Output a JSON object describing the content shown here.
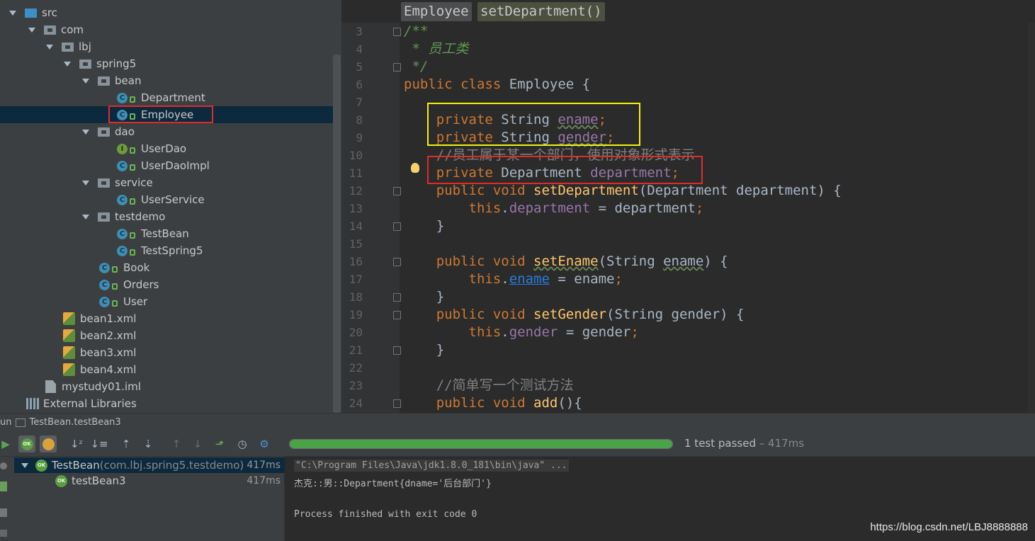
{
  "project_tree": {
    "items": [
      {
        "label": "src",
        "kind": "folder-src",
        "level": 0,
        "expanded": true
      },
      {
        "label": "com",
        "kind": "package",
        "level": 1,
        "expanded": true
      },
      {
        "label": "lbj",
        "kind": "package",
        "level": 2,
        "expanded": true
      },
      {
        "label": "spring5",
        "kind": "package",
        "level": 3,
        "expanded": true
      },
      {
        "label": "bean",
        "kind": "package",
        "level": 4,
        "expanded": true
      },
      {
        "label": "Department",
        "kind": "class",
        "level": 5
      },
      {
        "label": "Employee",
        "kind": "class",
        "level": 5,
        "selected": true
      },
      {
        "label": "dao",
        "kind": "package",
        "level": 4,
        "expanded": true
      },
      {
        "label": "UserDao",
        "kind": "interface",
        "level": 5
      },
      {
        "label": "UserDaoImpl",
        "kind": "class",
        "level": 5
      },
      {
        "label": "service",
        "kind": "package",
        "level": 4,
        "expanded": true
      },
      {
        "label": "UserService",
        "kind": "class",
        "level": 5
      },
      {
        "label": "testdemo",
        "kind": "package",
        "level": 4,
        "expanded": true
      },
      {
        "label": "TestBean",
        "kind": "class",
        "level": 5
      },
      {
        "label": "TestSpring5",
        "kind": "class",
        "level": 5
      },
      {
        "label": "Book",
        "kind": "class",
        "level": 4
      },
      {
        "label": "Orders",
        "kind": "class",
        "level": 4
      },
      {
        "label": "User",
        "kind": "class",
        "level": 4
      },
      {
        "label": "bean1.xml",
        "kind": "xml",
        "level": 2
      },
      {
        "label": "bean2.xml",
        "kind": "xml",
        "level": 2
      },
      {
        "label": "bean3.xml",
        "kind": "xml",
        "level": 2
      },
      {
        "label": "bean4.xml",
        "kind": "xml",
        "level": 2
      },
      {
        "label": "mystudy01.iml",
        "kind": "iml",
        "level": 1
      },
      {
        "label": "External Libraries",
        "kind": "libs",
        "level": 0
      }
    ]
  },
  "editor": {
    "breadcrumb": [
      "Employee",
      "setDepartment()"
    ],
    "lines": [
      {
        "num": "3",
        "tokens": [
          [
            "doc",
            "/**"
          ]
        ]
      },
      {
        "num": "4",
        "tokens": [
          [
            "doc",
            " * 员工类"
          ]
        ]
      },
      {
        "num": "5",
        "tokens": [
          [
            "doc",
            " */"
          ]
        ]
      },
      {
        "num": "6",
        "tokens": [
          [
            "kw",
            "public class "
          ],
          [
            "plain",
            "Employee {"
          ]
        ]
      },
      {
        "num": "7",
        "tokens": []
      },
      {
        "num": "8",
        "tokens": [
          [
            "plain",
            "    "
          ],
          [
            "kw",
            "private "
          ],
          [
            "plain",
            "String "
          ],
          [
            "fld squig",
            "ename"
          ],
          [
            "kw",
            ";"
          ]
        ]
      },
      {
        "num": "9",
        "tokens": [
          [
            "plain",
            "    "
          ],
          [
            "kw",
            "private "
          ],
          [
            "plain",
            "String "
          ],
          [
            "fld squig",
            "gender"
          ],
          [
            "kw",
            ";"
          ]
        ]
      },
      {
        "num": "10",
        "tokens": [
          [
            "cmt",
            "    //员工属于某一个部门，使用对象形式表示"
          ]
        ]
      },
      {
        "num": "11",
        "tokens": [
          [
            "plain",
            "    "
          ],
          [
            "kw",
            "private "
          ],
          [
            "plain",
            "Department "
          ],
          [
            "fld",
            "department"
          ],
          [
            "kw",
            ";"
          ]
        ]
      },
      {
        "num": "12",
        "tokens": [
          [
            "plain",
            "    "
          ],
          [
            "kw",
            "public void "
          ],
          [
            "fn",
            "setDepartment"
          ],
          [
            "plain",
            "(Department department) {"
          ]
        ]
      },
      {
        "num": "13",
        "tokens": [
          [
            "plain",
            "        "
          ],
          [
            "kw",
            "this"
          ],
          [
            "plain",
            "."
          ],
          [
            "fld",
            "department"
          ],
          [
            "plain",
            " = department"
          ],
          [
            "kw",
            ";"
          ]
        ]
      },
      {
        "num": "14",
        "tokens": [
          [
            "plain",
            "    }"
          ]
        ]
      },
      {
        "num": "15",
        "tokens": []
      },
      {
        "num": "16",
        "tokens": [
          [
            "plain",
            "    "
          ],
          [
            "kw",
            "public void "
          ],
          [
            "fn squig",
            "setEname"
          ],
          [
            "plain",
            "(String "
          ],
          [
            "plain squig",
            "ename"
          ],
          [
            "plain",
            ") {"
          ]
        ]
      },
      {
        "num": "17",
        "tokens": [
          [
            "plain",
            "        "
          ],
          [
            "kw",
            "this"
          ],
          [
            "plain",
            "."
          ],
          [
            "link",
            "ename"
          ],
          [
            "plain",
            " = ename"
          ],
          [
            "kw",
            ";"
          ]
        ]
      },
      {
        "num": "18",
        "tokens": [
          [
            "plain",
            "    }"
          ]
        ]
      },
      {
        "num": "19",
        "tokens": [
          [
            "plain",
            "    "
          ],
          [
            "kw",
            "public void "
          ],
          [
            "fn",
            "setGender"
          ],
          [
            "plain",
            "(String gender) {"
          ]
        ]
      },
      {
        "num": "20",
        "tokens": [
          [
            "plain",
            "        "
          ],
          [
            "kw",
            "this"
          ],
          [
            "plain",
            "."
          ],
          [
            "fld",
            "gender"
          ],
          [
            "plain",
            " = gender"
          ],
          [
            "kw",
            ";"
          ]
        ]
      },
      {
        "num": "21",
        "tokens": [
          [
            "plain",
            "    }"
          ]
        ]
      },
      {
        "num": "22",
        "tokens": []
      },
      {
        "num": "23",
        "tokens": [
          [
            "cmt",
            "    //简单写一个测试方法"
          ]
        ]
      },
      {
        "num": "24",
        "tokens": [
          [
            "plain",
            "    "
          ],
          [
            "kw",
            "public void "
          ],
          [
            "fn",
            "add"
          ],
          [
            "plain",
            "(){"
          ]
        ]
      }
    ]
  },
  "run_panel": {
    "tab_prefix": "un",
    "tab_label": "TestBean.testBean3",
    "status_main": "1 test passed",
    "status_time": " – 417ms",
    "progress_fraction": 1.0,
    "tests": [
      {
        "name": "TestBean",
        "detail": " (com.lbj.spring5.testdemo)",
        "time": "417ms",
        "status": "OK"
      },
      {
        "name": "testBean3",
        "detail": "",
        "time": "417ms",
        "status": "OK"
      }
    ],
    "console": {
      "command": "\"C:\\Program Files\\Java\\jdk1.8.0_181\\bin\\java\" ...",
      "output": "杰克::男::Department{dname='后台部门'}",
      "exit": "Process finished with exit code 0"
    },
    "toolbar_icons": [
      "rerun-icon",
      "show-passed-icon",
      "show-ignored-icon",
      "sort-alpha-icon",
      "sort-duration-icon",
      "expand-all-icon",
      "collapse-all-icon",
      "prev-failed-icon",
      "next-failed-icon",
      "export-icon",
      "history-icon",
      "settings-icon"
    ]
  },
  "watermark": "https://blog.csdn.net/LBJ8888888",
  "colors": {
    "keyword": "#cc7832",
    "field": "#9876aa",
    "method": "#ffc66d",
    "doc": "#629755",
    "comment": "#808080",
    "yellow_box": "#f2f20f",
    "red_box": "#e02b2b",
    "progress": "#4aa249"
  }
}
